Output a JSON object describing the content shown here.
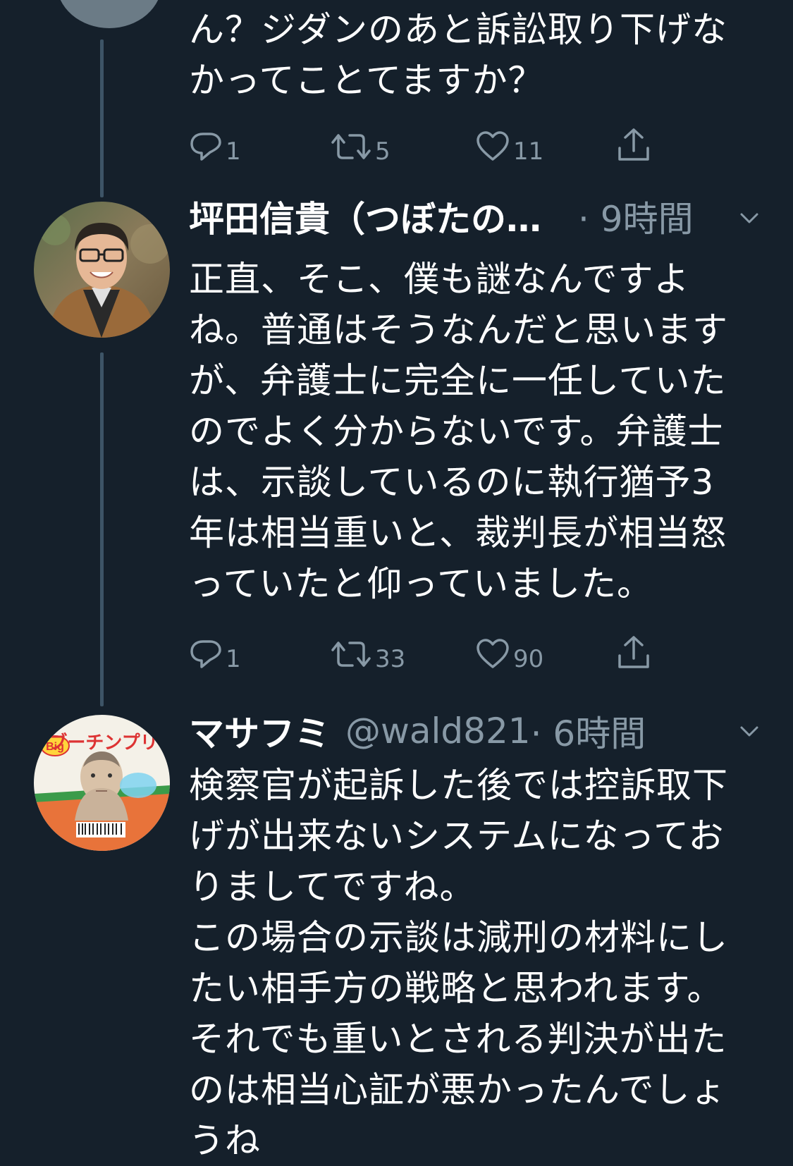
{
  "colors": {
    "background": "#15202b",
    "text": "#ffffff",
    "secondary": "#8899a6",
    "thread_line": "#3d5466"
  },
  "tweets": [
    {
      "text_lines": [
        "ん？ジダンのあと訴訟取り下げな",
        "かってことてますか？"
      ],
      "actions": {
        "reply": "1",
        "retweet": "5",
        "like": "11"
      }
    },
    {
      "name": "坪田信貴（つぼたの…",
      "time": "· 9時間",
      "text_lines": [
        "正直、そこ、僕も謎なんですよ",
        "ね。普通はそうなんだと思います",
        "が、弁護士に完全に一任していた",
        "のでよく分からないです。弁護士",
        "は、示談しているのに執行猶予3",
        "年は相当重いと、裁判長が相当怒",
        "っていたと仰っていました。"
      ],
      "actions": {
        "reply": "1",
        "retweet": "33",
        "like": "90"
      }
    },
    {
      "name": "マサフミ",
      "handle": "@wald821",
      "time": "· 6時間",
      "avatar_label": "ブーチンプリン",
      "avatar_badge": "Big",
      "text_lines": [
        "検察官が起訴した後では控訴取下",
        "げが出来ないシステムになってお",
        "りましてですね。",
        "この場合の示談は減刑の材料にし",
        "たい相手方の戦略と思われます。",
        "それでも重いとされる判決が出た",
        "のは相当心証が悪かったんでしょ",
        "うね"
      ]
    }
  ]
}
